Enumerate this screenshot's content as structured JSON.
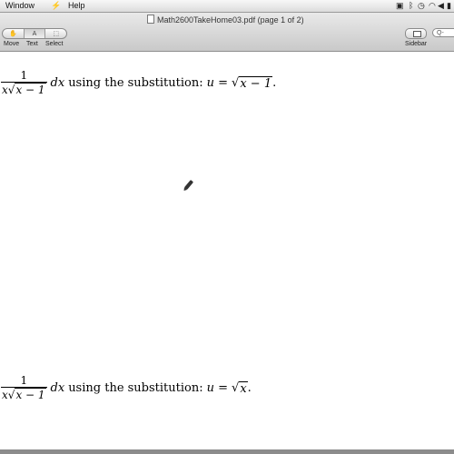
{
  "menubar": {
    "items": [
      "Window",
      "Help"
    ],
    "status_icons": [
      "bolt-icon",
      "video-icon",
      "bluetooth-icon",
      "clock-icon",
      "wifi-icon",
      "speaker-icon",
      "battery-icon"
    ]
  },
  "toolbar": {
    "document_title": "Math2600TakeHome03.pdf (page 1 of 2)",
    "tools": [
      {
        "label": "Move",
        "icon": "hand-icon"
      },
      {
        "label": "Text",
        "icon": "text-select-icon"
      },
      {
        "label": "Select",
        "icon": "marquee-icon"
      }
    ],
    "sidebar_label": "Sidebar",
    "search_placeholder": "Q-"
  },
  "document": {
    "problem1": {
      "numerator": "1",
      "denominator_var": "x",
      "denominator_radicand": "x − 1",
      "differential": "dx",
      "text": "using the substitution:",
      "substitution_lhs": "u =",
      "substitution_radicand": "x − 1",
      "terminator": "."
    },
    "problem2": {
      "numerator": "1",
      "denominator_var": "x",
      "denominator_radicand": "x − 1",
      "differential": "dx",
      "text": "using the substitution:",
      "substitution_lhs": "u =",
      "substitution_radicand": "x",
      "terminator": "."
    }
  },
  "colors": {
    "toolbar_top": "#e9e9e9",
    "toolbar_bottom": "#c9c9c9",
    "page_background": "#ffffff"
  }
}
